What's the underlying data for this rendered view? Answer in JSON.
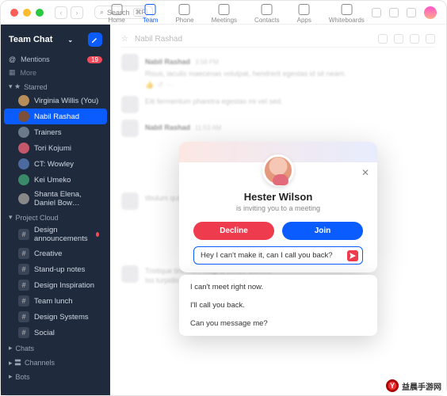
{
  "chrome": {
    "search_placeholder": "Search",
    "hotkey": "⌘F"
  },
  "topnav": [
    {
      "icon": "home-icon",
      "label": "Home"
    },
    {
      "icon": "chat-icon",
      "label": "Team Chat",
      "active": true
    },
    {
      "icon": "phone-icon",
      "label": "Phone"
    },
    {
      "icon": "video-icon",
      "label": "Meetings"
    },
    {
      "icon": "contacts-icon",
      "label": "Contacts"
    },
    {
      "icon": "apps-icon",
      "label": "Apps"
    },
    {
      "icon": "board-icon",
      "label": "Whiteboards"
    }
  ],
  "sidebar": {
    "title": "Team Chat",
    "mentions_label": "Mentions",
    "mentions_badge": "19",
    "more_label": "More",
    "sections": {
      "starred": "Starred",
      "project": "Project Cloud",
      "chats": "Chats",
      "channels": "Channels",
      "bots": "Bots"
    },
    "starred": [
      {
        "label": "Virginia Willis (You)"
      },
      {
        "label": "Nabil Rashad",
        "selected": true
      },
      {
        "label": "Trainers"
      },
      {
        "label": "Tori Kojumi"
      },
      {
        "label": "CT: Wowley"
      },
      {
        "label": "Kei Umeko"
      },
      {
        "label": "Shanta Elena, Daniel Bow…"
      }
    ],
    "project": [
      {
        "label": "Design announcements",
        "alert": true
      },
      {
        "label": "Creative"
      },
      {
        "label": "Stand-up notes"
      },
      {
        "label": "Design Inspiration"
      },
      {
        "label": "Team lunch"
      },
      {
        "label": "Design Systems"
      },
      {
        "label": "Social"
      }
    ]
  },
  "thread": {
    "header_name": "Nabil Rashad",
    "msgs": [
      {
        "name": "Nabil Rashad",
        "time": "3:58 PM",
        "body": "Risus, iaculis maecenas volutpat, hendrerit egestas id sit neam."
      },
      {
        "name": "",
        "time": "",
        "body": "Eiti fermentum pharetra egestas mi vel sed."
      },
      {
        "name": "Nabil Rashad",
        "time": "11:53 AM",
        "body": ""
      },
      {
        "name": "",
        "time": "",
        "body": "tibulum quis, nullorate. Vitae commodo molla nisi ac sapie."
      },
      {
        "name": "",
        "time": "",
        "body": "Tristique tincidunt magna donec ultrices."
      },
      {
        "name": "",
        "time": "",
        "body": "Iss turpidis hos wies mytest"
      }
    ]
  },
  "modal": {
    "caller": "Hester Wilson",
    "subtext": "is inviting you to a meeting",
    "decline": "Decline",
    "join": "Join",
    "quick_reply": "Hey I can't make it, can I call you back?",
    "suggestions": [
      "I can't meet right now.",
      "I'll call you back.",
      "Can you message me?"
    ]
  },
  "watermark": "益晨手游网"
}
